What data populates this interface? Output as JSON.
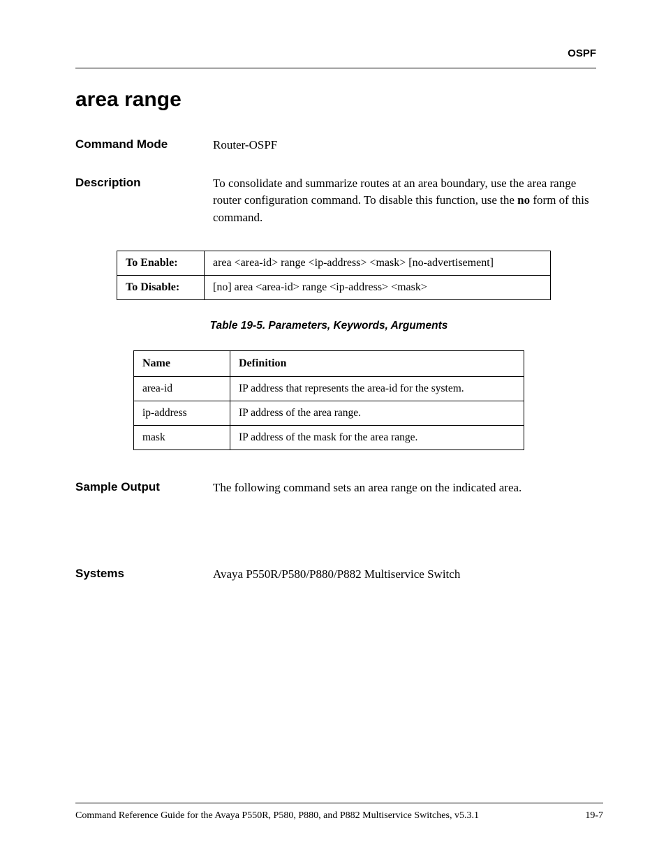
{
  "header": {
    "section": "OSPF"
  },
  "title": "area range",
  "command_mode": {
    "label": "Command Mode",
    "value": "Router-OSPF"
  },
  "description": {
    "label": "Description",
    "text_before": "To consolidate and summarize routes at an area boundary, use the area range router configuration command. To disable this function, use the ",
    "bold_word": "no",
    "text_after": " form of this command."
  },
  "syntax_table": {
    "enable_label": "To Enable:",
    "enable_value": "area <area-id> range <ip-address> <mask> [no-advertisement]",
    "disable_label": "To Disable:",
    "disable_value": "[no] area <area-id> range <ip-address> <mask>"
  },
  "table_caption": "Table 19-5.  Parameters, Keywords, Arguments",
  "params_table": {
    "headers": {
      "name": "Name",
      "definition": "Definition"
    },
    "rows": [
      {
        "name": "area-id",
        "definition": "IP address that represents the area-id for the system."
      },
      {
        "name": "ip-address",
        "definition": "IP address of the area range."
      },
      {
        "name": "mask",
        "definition": "IP address of the mask for the area range."
      }
    ]
  },
  "sample_output": {
    "label": "Sample Output",
    "value": "The following command sets an area range on the indicated area."
  },
  "systems": {
    "label": "Systems",
    "value": "Avaya P550R/P580/P880/P882 Multiservice Switch"
  },
  "footer": {
    "left": "Command Reference Guide for the Avaya P550R, P580, P880, and P882 Multiservice Switches, v5.3.1",
    "right": "19-7"
  }
}
